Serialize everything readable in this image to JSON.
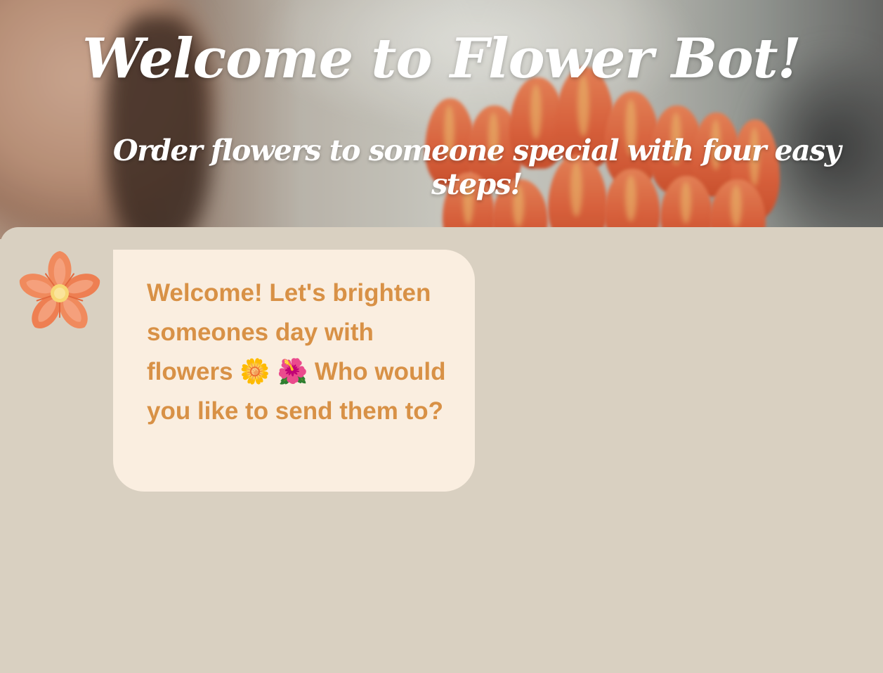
{
  "header": {
    "title": "Welcome to Flower Bot!",
    "subtitle": "Order flowers to someone special with four easy steps!",
    "background_image": "woman-smelling-orange-tulips-photo"
  },
  "chat": {
    "messages": [
      {
        "sender": "bot",
        "avatar_icon": "flower-icon",
        "text": "Welcome! Let's brighten someones day with flowers 🌼 🌺 Who would you like to send them to?"
      }
    ]
  },
  "colors": {
    "page_background": "#d9d0c1",
    "bubble_background": "#faeee0",
    "bubble_text": "#d89146",
    "avatar_petals": "#f08a5d",
    "avatar_center": "#f7d774",
    "title_text": "#ffffff"
  }
}
